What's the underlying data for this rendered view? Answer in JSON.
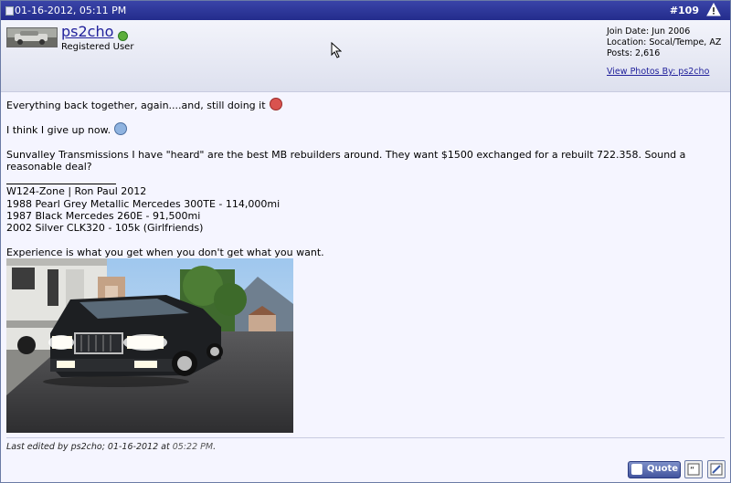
{
  "post": {
    "date": "01-16-2012, 05:11 PM",
    "number": "#109"
  },
  "user": {
    "name": "ps2cho",
    "title": "Registered User",
    "join_date": "Join Date: Jun 2006",
    "location": "Location: Socal/Tempe, AZ",
    "posts": "Posts: 2,616",
    "photos_link": "View Photos By: ps2cho"
  },
  "message": {
    "line1": "Everything back together, again....and, still doing it",
    "line2": "I think I give up now.",
    "line3": "Sunvalley Transmissions I have \"heard\" are the best MB rebuilders around. They want $1500 exchanged for a rebuilt 722.358. Sound a",
    "line4": "reasonable deal?"
  },
  "signature": {
    "lines": [
      "W124-Zone | Ron Paul 2012",
      "1988 Pearl Grey Metallic Mercedes 300TE - 114,000mi",
      "1987 Black Mercedes 260E - 91,500mi",
      "2002 Silver CLK320 - 105k (Girlfriends)"
    ],
    "quote": "Experience is what you get when you don't get what you want."
  },
  "footer": {
    "edited_prefix": "Last edited by ps2cho; 01-16-2012 at",
    "edited_time": "05:22 PM",
    "edited_suffix": "."
  },
  "buttons": {
    "quote_label": "Quote"
  },
  "icons": {
    "report": "warning-icon",
    "online": "online-status-icon",
    "angry_smilie": "angry-smilie-icon",
    "sad_smilie": "sad-smilie-icon",
    "multiquote": "multiquote-icon",
    "quick_reply": "quick-reply-icon"
  },
  "colors": {
    "header_bar": "#2a3296",
    "link": "#22229c",
    "online": "#5cae3b",
    "quote_button": "#5a6cb2"
  }
}
